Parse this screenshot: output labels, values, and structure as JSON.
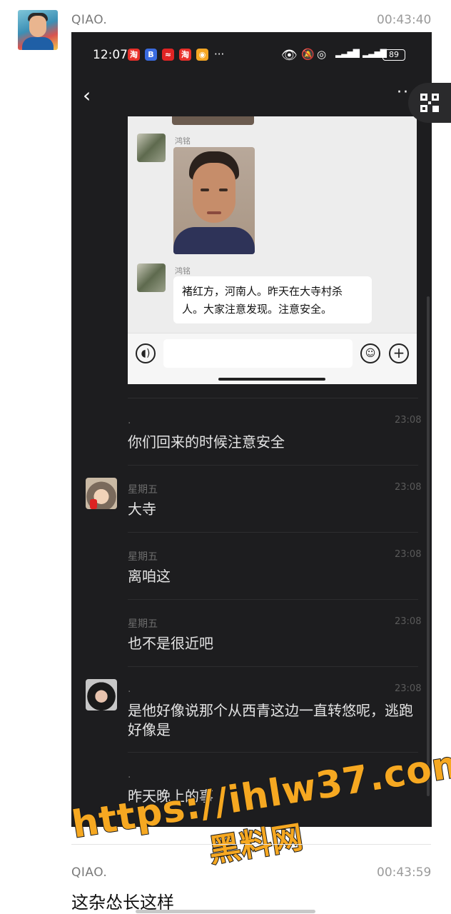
{
  "outer": {
    "top_message": {
      "sender": "QIAO.",
      "time": "00:43:40"
    },
    "bottom_message": {
      "sender": "QIAO.",
      "time": "00:43:59",
      "text": "这杂怂长这样"
    }
  },
  "phone": {
    "status_bar": {
      "time": "12:07",
      "ellipsis": "···",
      "battery": "89"
    },
    "nav": {
      "back": "‹",
      "more": "··"
    },
    "inner_screenshot": {
      "name_1": "鸿铭",
      "name_2": "鸿铭",
      "bubble_text": "褚红方，河南人。昨天在大寺村杀人。大家注意发现。注意安全。"
    },
    "messages": [
      {
        "name": ".",
        "time": "23:08",
        "text": "你们回来的时候注意安全"
      },
      {
        "name": "星期五",
        "time": "23:08",
        "text": "大寺"
      },
      {
        "name": "星期五",
        "time": "23:08",
        "text": "离咱这"
      },
      {
        "name": "星期五",
        "time": "23:08",
        "text": "也不是很近吧"
      },
      {
        "name": ".",
        "time": "23:08",
        "text": "是他好像说那个从西青这边一直转悠呢，逃跑好像是"
      },
      {
        "name": ".",
        "time": "",
        "text": "昨天晚上的事"
      }
    ]
  },
  "watermark": {
    "line1": "https://ihlw37.com",
    "line2": "黑料网"
  },
  "colors": {
    "watermark": "#f6a821",
    "phone_bg": "#1d1d1f"
  }
}
